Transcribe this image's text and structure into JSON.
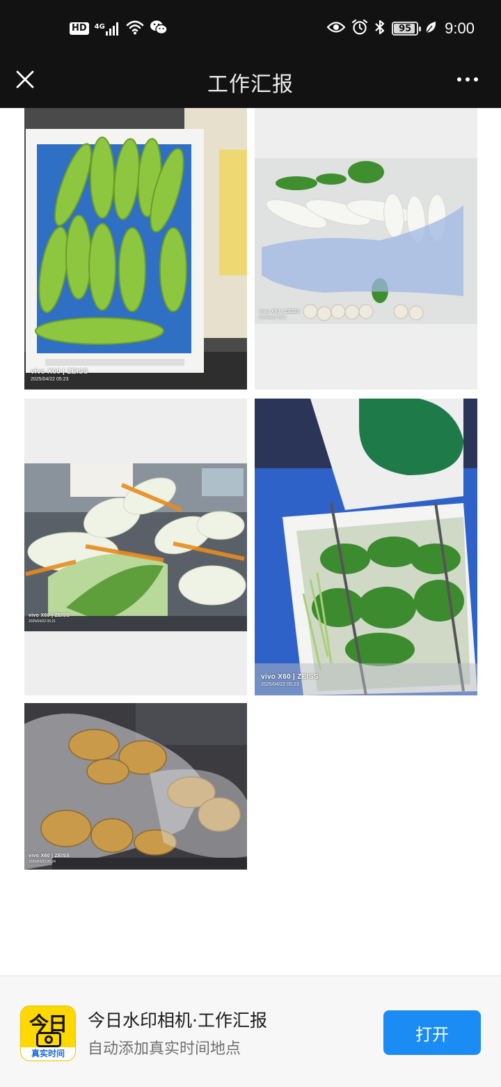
{
  "status_bar": {
    "hd": "HD",
    "network": "4G",
    "battery": "95",
    "battery_level": 0.95,
    "time": "9:00"
  },
  "title_bar": {
    "title": "工作汇报",
    "close_icon": "close-icon",
    "more_icon": "more-icon"
  },
  "photos": [
    {
      "subject": "zucchini",
      "watermark": "vivo X60 | ZEISS",
      "timestamp": "2025/04/22 05:23"
    },
    {
      "subject": "radish",
      "watermark": "vivo X60 | ZEISS",
      "timestamp": "2025/04/22 05:23"
    },
    {
      "subject": "napa-cabbage",
      "watermark": "vivo X60 | ZEISS",
      "timestamp": "2025/04/22 05:21"
    },
    {
      "subject": "leafy-greens",
      "watermark": "vivo X60 | ZEISS",
      "timestamp": "2025/04/22 05:23"
    },
    {
      "subject": "ginger",
      "watermark": "vivo X60 | ZEISS",
      "timestamp": "2025/04/22 05:24"
    }
  ],
  "promo": {
    "icon_text": "今日",
    "icon_strip": "真实时间",
    "title": "今日水印相机·工作汇报",
    "subtitle": "自动添加真实时间地点",
    "open_label": "打开"
  },
  "colors": {
    "bar_background": "#121212",
    "button_blue": "#1a8cf3",
    "icon_yellow": "#ffd800"
  }
}
